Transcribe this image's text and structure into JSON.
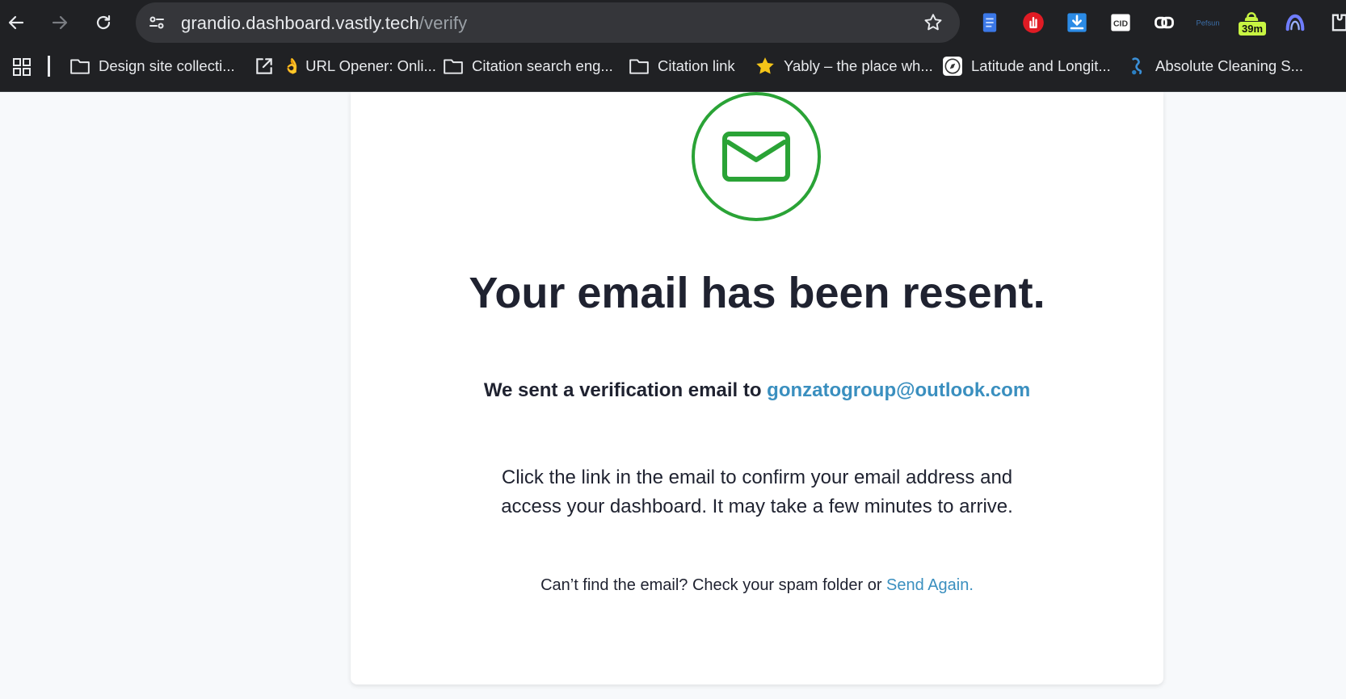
{
  "browser": {
    "url_host": "grandio.dashboard.vastly.tech",
    "url_path": "/verify",
    "extensions": [
      {
        "name": "docs-icon",
        "color": "#4a8af4"
      },
      {
        "name": "adblock-icon",
        "color": "#e01b24"
      },
      {
        "name": "download-icon",
        "color": "#2b8be6"
      },
      {
        "name": "cid-icon",
        "color": "#ffffff"
      },
      {
        "name": "link-icon",
        "color": "#ffffff"
      },
      {
        "name": "pefsun-icon",
        "color": "#3b6ea8"
      },
      {
        "name": "timer-icon",
        "color": "#c8f542"
      },
      {
        "name": "arc-icon",
        "color": "#6f7dff"
      }
    ],
    "timer_badge": "39m",
    "bookmarks": [
      {
        "icon": "folder-icon",
        "label": "Design site collecti..."
      },
      {
        "icon": "open-external-icon",
        "label": "👌 URL Opener: Onli..."
      },
      {
        "icon": "folder-icon",
        "label": "Citation search eng..."
      },
      {
        "icon": "folder-icon",
        "label": "Citation link"
      },
      {
        "icon": "star-icon",
        "label": "Yably – the place wh..."
      },
      {
        "icon": "compass-icon",
        "label": "Latitude and Longit..."
      },
      {
        "icon": "cleaning-icon",
        "label": "Absolute Cleaning S..."
      }
    ]
  },
  "page": {
    "headline": "Your email has been resent.",
    "sent_prefix": "We sent a verification email to ",
    "email": "gonzatogroup@outlook.com",
    "instructions": "Click the link in the email to confirm your email address and access your dashboard. It may take a few minutes to arrive.",
    "spam_prefix": "Can’t find the email? Check your spam folder or ",
    "send_again": "Send Again.",
    "colors": {
      "accent_green": "#2aa336",
      "link_blue": "#3a8fbf",
      "text_dark": "#1f2230"
    }
  }
}
